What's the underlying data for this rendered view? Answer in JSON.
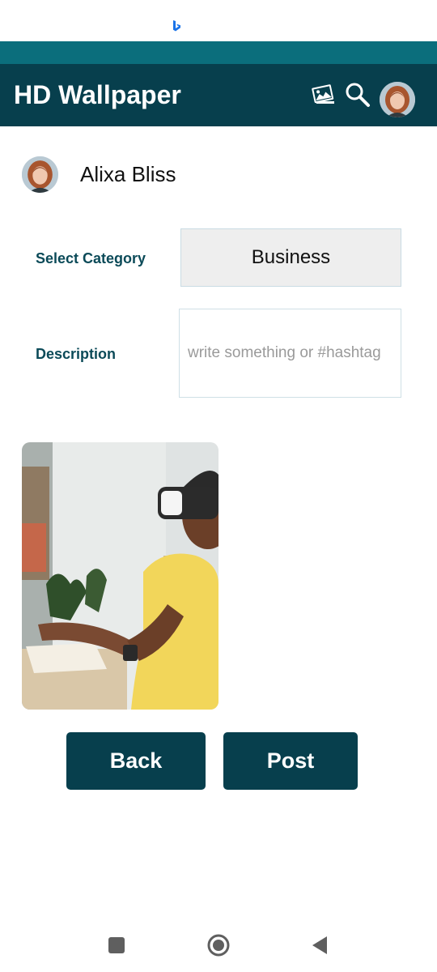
{
  "status_bar": {
    "notification_icon": "bing-icon"
  },
  "app_bar": {
    "title": "HD Wallpaper",
    "icons": [
      "gallery-icon",
      "search-icon",
      "avatar"
    ]
  },
  "user": {
    "name": "Alixa Bliss"
  },
  "form": {
    "category_label": "Select Category",
    "category_value": "Business",
    "description_label": "Description",
    "description_placeholder": "write something or #hashtag",
    "description_value": ""
  },
  "actions": {
    "back_label": "Back",
    "post_label": "Post"
  },
  "nav": [
    "recent-apps-icon",
    "home-icon",
    "back-icon"
  ],
  "colors": {
    "app_bar": "#073f4d",
    "status_strip": "#0b6e7c",
    "label_text": "#0b4a58",
    "button": "#073f4d"
  }
}
